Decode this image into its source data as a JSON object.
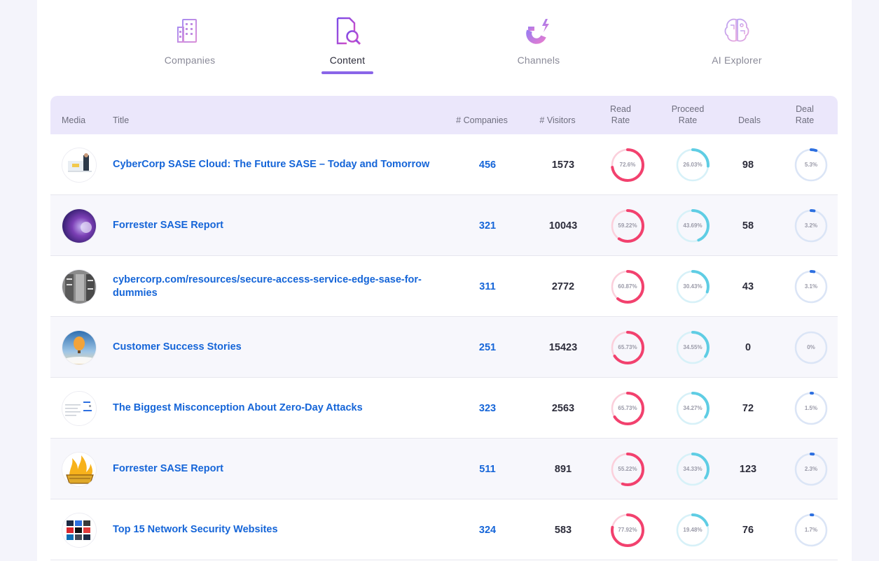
{
  "tabs": [
    {
      "label": "Companies",
      "icon": "building-icon",
      "active": false
    },
    {
      "label": "Content",
      "icon": "document-search-icon",
      "active": true
    },
    {
      "label": "Channels",
      "icon": "magnet-icon",
      "active": false
    },
    {
      "label": "AI Explorer",
      "icon": "brain-icon",
      "active": false
    }
  ],
  "table": {
    "headers": {
      "media": "Media",
      "title": "Title",
      "companies": "# Companies",
      "visitors": "# Visitors",
      "read_rate_1": "Read",
      "read_rate_2": "Rate",
      "proceed_rate_1": "Proceed",
      "proceed_rate_2": "Rate",
      "deals": "Deals",
      "deal_rate_1": "Deal",
      "deal_rate_2": "Rate"
    },
    "rows": [
      {
        "title": "CyberCorp SASE Cloud: The Future SASE – Today and Tomorrow",
        "companies": "456",
        "visitors": "1573",
        "read_rate": "72.6%",
        "read_value": 72.6,
        "proceed_rate": "26.03%",
        "proceed_value": 26.03,
        "deals": "98",
        "deal_rate": "5.3%",
        "deal_value": 5.3
      },
      {
        "title": "Forrester SASE Report",
        "companies": "321",
        "visitors": "10043",
        "read_rate": "59.22%",
        "read_value": 59.22,
        "proceed_rate": "43.69%",
        "proceed_value": 43.69,
        "deals": "58",
        "deal_rate": "3.2%",
        "deal_value": 3.2
      },
      {
        "title": "cybercorp.com/resources/secure-access-service-edge-sase-for-dummies",
        "companies": "311",
        "visitors": "2772",
        "read_rate": "60.87%",
        "read_value": 60.87,
        "proceed_rate": "30.43%",
        "proceed_value": 30.43,
        "deals": "43",
        "deal_rate": "3.1%",
        "deal_value": 3.1
      },
      {
        "title": "Customer Success Stories",
        "companies": "251",
        "visitors": "15423",
        "read_rate": "65.73%",
        "read_value": 65.73,
        "proceed_rate": "34.55%",
        "proceed_value": 34.55,
        "deals": "0",
        "deal_rate": "0%",
        "deal_value": 0
      },
      {
        "title": "The Biggest Misconception About Zero-Day Attacks",
        "companies": "323",
        "visitors": "2563",
        "read_rate": "65.73%",
        "read_value": 65.73,
        "proceed_rate": "34.27%",
        "proceed_value": 34.27,
        "deals": "72",
        "deal_rate": "1.5%",
        "deal_value": 1.5
      },
      {
        "title": "Forrester SASE Report",
        "companies": "511",
        "visitors": "891",
        "read_rate": "55.22%",
        "read_value": 55.22,
        "proceed_rate": "34.33%",
        "proceed_value": 34.33,
        "deals": "123",
        "deal_rate": "2.3%",
        "deal_value": 2.3
      },
      {
        "title": "Top 15 Network Security Websites",
        "companies": "324",
        "visitors": "583",
        "read_rate": "77.92%",
        "read_value": 77.92,
        "proceed_rate": "19.48%",
        "proceed_value": 19.48,
        "deals": "76",
        "deal_rate": "1.7%",
        "deal_value": 1.7
      }
    ]
  },
  "colors": {
    "accent": "#8a65e8",
    "link": "#1565d8",
    "read_ring": "#f2416e",
    "read_track": "#fbd0dc",
    "proceed_ring": "#5fcde4",
    "proceed_track": "#d7f1f8",
    "deal_ring": "#2d6fe0",
    "deal_track": "#dbe5f6"
  }
}
